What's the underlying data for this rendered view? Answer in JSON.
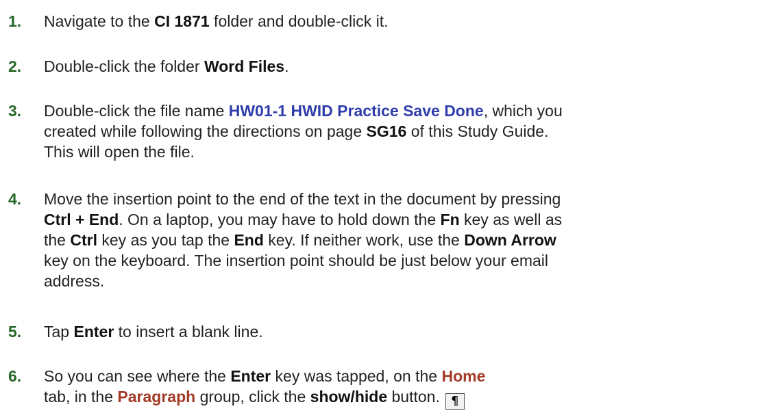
{
  "steps": [
    {
      "num": "1.",
      "lines": [
        [
          {
            "t": "Navigate to the ",
            "s": "n"
          },
          {
            "t": "CI 1871",
            "s": "b"
          },
          {
            "t": " folder and double-click it.",
            "s": "n"
          }
        ]
      ]
    },
    {
      "num": "2.",
      "lines": [
        [
          {
            "t": "Double-click the folder ",
            "s": "n"
          },
          {
            "t": "Word Files",
            "s": "b"
          },
          {
            "t": ".",
            "s": "n"
          }
        ]
      ]
    },
    {
      "num": "3.",
      "lines": [
        [
          {
            "t": "Double-click the file name ",
            "s": "n"
          },
          {
            "t": "HW01-1 HWID Practice Save Done",
            "s": "blue"
          },
          {
            "t": ", which you",
            "s": "n"
          }
        ],
        [
          {
            "t": "created while following the directions on page ",
            "s": "n"
          },
          {
            "t": "SG16",
            "s": "b"
          },
          {
            "t": " of this Study Guide.",
            "s": "n"
          }
        ],
        [
          {
            "t": "This will open the file.",
            "s": "n"
          }
        ]
      ]
    },
    {
      "num": "4.",
      "lines": [
        [
          {
            "t": "Move the insertion point to the end of the text in the document by pressing",
            "s": "n"
          }
        ],
        [
          {
            "t": "Ctrl + End",
            "s": "b"
          },
          {
            "t": ". On a laptop, you may have to hold down the ",
            "s": "n"
          },
          {
            "t": "Fn",
            "s": "b"
          },
          {
            "t": " key as well as",
            "s": "n"
          }
        ],
        [
          {
            "t": "the ",
            "s": "n"
          },
          {
            "t": "Ctrl",
            "s": "b"
          },
          {
            "t": " key as you tap the ",
            "s": "n"
          },
          {
            "t": "End",
            "s": "b"
          },
          {
            "t": " key. If neither work, use the ",
            "s": "n"
          },
          {
            "t": "Down Arrow",
            "s": "b"
          }
        ],
        [
          {
            "t": "key on the keyboard. The insertion point should be just below your email",
            "s": "n"
          }
        ],
        [
          {
            "t": "address.",
            "s": "n"
          }
        ]
      ]
    },
    {
      "num": "5.",
      "lines": [
        [
          {
            "t": "Tap ",
            "s": "n"
          },
          {
            "t": "Enter",
            "s": "b"
          },
          {
            "t": " to insert a blank line.",
            "s": "n"
          }
        ]
      ]
    },
    {
      "num": "6.",
      "lines": [
        [
          {
            "t": "So you can see where the ",
            "s": "n"
          },
          {
            "t": "Enter",
            "s": "b"
          },
          {
            "t": " key was tapped, on the ",
            "s": "n"
          },
          {
            "t": "Home",
            "s": "red"
          }
        ],
        [
          {
            "t": "tab, in the ",
            "s": "n"
          },
          {
            "t": "Paragraph",
            "s": "red"
          },
          {
            "t": " group, click the ",
            "s": "n"
          },
          {
            "t": "show/hide",
            "s": "b"
          },
          {
            "t": " button.",
            "s": "n"
          }
        ]
      ]
    }
  ],
  "show_hide_button": {
    "icon": "pilcrow-icon",
    "glyph": "¶"
  },
  "colors": {
    "step_number": "#27672a",
    "file_name": "#2e3dab",
    "ribbon_reference": "#a33a26",
    "text": "#222222"
  }
}
